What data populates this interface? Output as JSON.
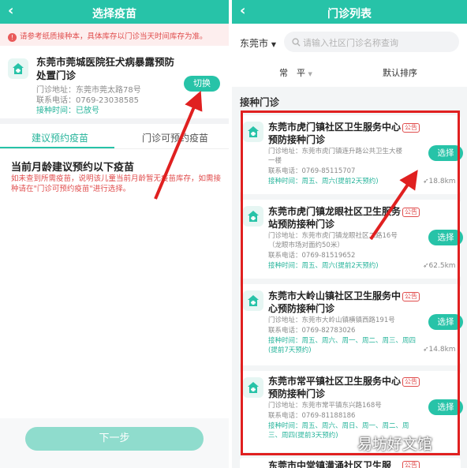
{
  "left": {
    "title": "选择疫苗",
    "notice": "请参考纸质接种本，具体库存以门诊当天时间库存为准。",
    "hospital_name": "东莞市莞城医院狂犬病暴露预防处置门诊",
    "address": "门诊地址：东莞市莞太路78号",
    "phone": "联系电话：0769-23038585",
    "hours": "接种时间：已放号",
    "switch_label": "切换",
    "tabs": [
      "建议预约疫苗",
      "门诊可预约疫苗"
    ],
    "heading": "当前月龄建议预约以下疫苗",
    "warning": "如未查到所需疫苗，说明该儿童当前月龄暂无疫苗库存，如需接种请在\"门诊可预约疫苗\"进行选择。",
    "next_label": "下一步"
  },
  "right": {
    "title": "门诊列表",
    "city": "东莞市",
    "search_placeholder": "请输入社区门诊名称查询",
    "sort_left": "常　平",
    "sort_right": "默认排序",
    "section_title": "接种门诊",
    "clinics": [
      {
        "name": "东莞市虎门镇社区卫生服务中心预防接种门诊",
        "badge": "公告",
        "address": "门诊地址：东莞市虎门镇连升路公共卫生大楼一楼",
        "phone": "联系电话：0769-85115707",
        "hours": "接种时间：周五、周六(提前2天预约)",
        "select_label": "选择",
        "distance": "18.8km"
      },
      {
        "name": "东莞市虎门镇龙眼社区卫生服务站预防接种门诊",
        "badge": "公告",
        "address": "门诊地址：东莞市虎门镇龙眼社区二路16号（龙眼市场对面约50米）",
        "phone": "联系电话：0769-81519652",
        "hours": "接种时间：周五、周六(提前2天预约)",
        "select_label": "选择",
        "distance": "62.5km"
      },
      {
        "name": "东莞市大岭山镇社区卫生服务中心预防接种门诊",
        "badge": "公告",
        "address": "门诊地址：东莞市大岭山镇横镇西路191号",
        "phone": "联系电话：0769-82783026",
        "hours": "接种时间：周五、周六、周一、周二、周三、周四(提前7天预约)",
        "select_label": "选择",
        "distance": "14.8km"
      },
      {
        "name": "东莞市常平镇社区卫生服务中心预防接种门诊",
        "badge": "公告",
        "address": "门诊地址：东莞市常平镇东兴路168号",
        "phone": "联系电话：0769-81188186",
        "hours": "接种时间：周五、周六、周日、周一、周二、周三、周四(提前3天预约)",
        "select_label": "选择",
        "distance": ""
      },
      {
        "name": "东莞市中堂镇潢涌社区卫生服",
        "badge": "公告"
      }
    ]
  },
  "watermark": "易坊好文馆",
  "colors": {
    "accent": "#27c3a8",
    "annotation_red": "#e02020",
    "warning": "#e04d4d"
  }
}
